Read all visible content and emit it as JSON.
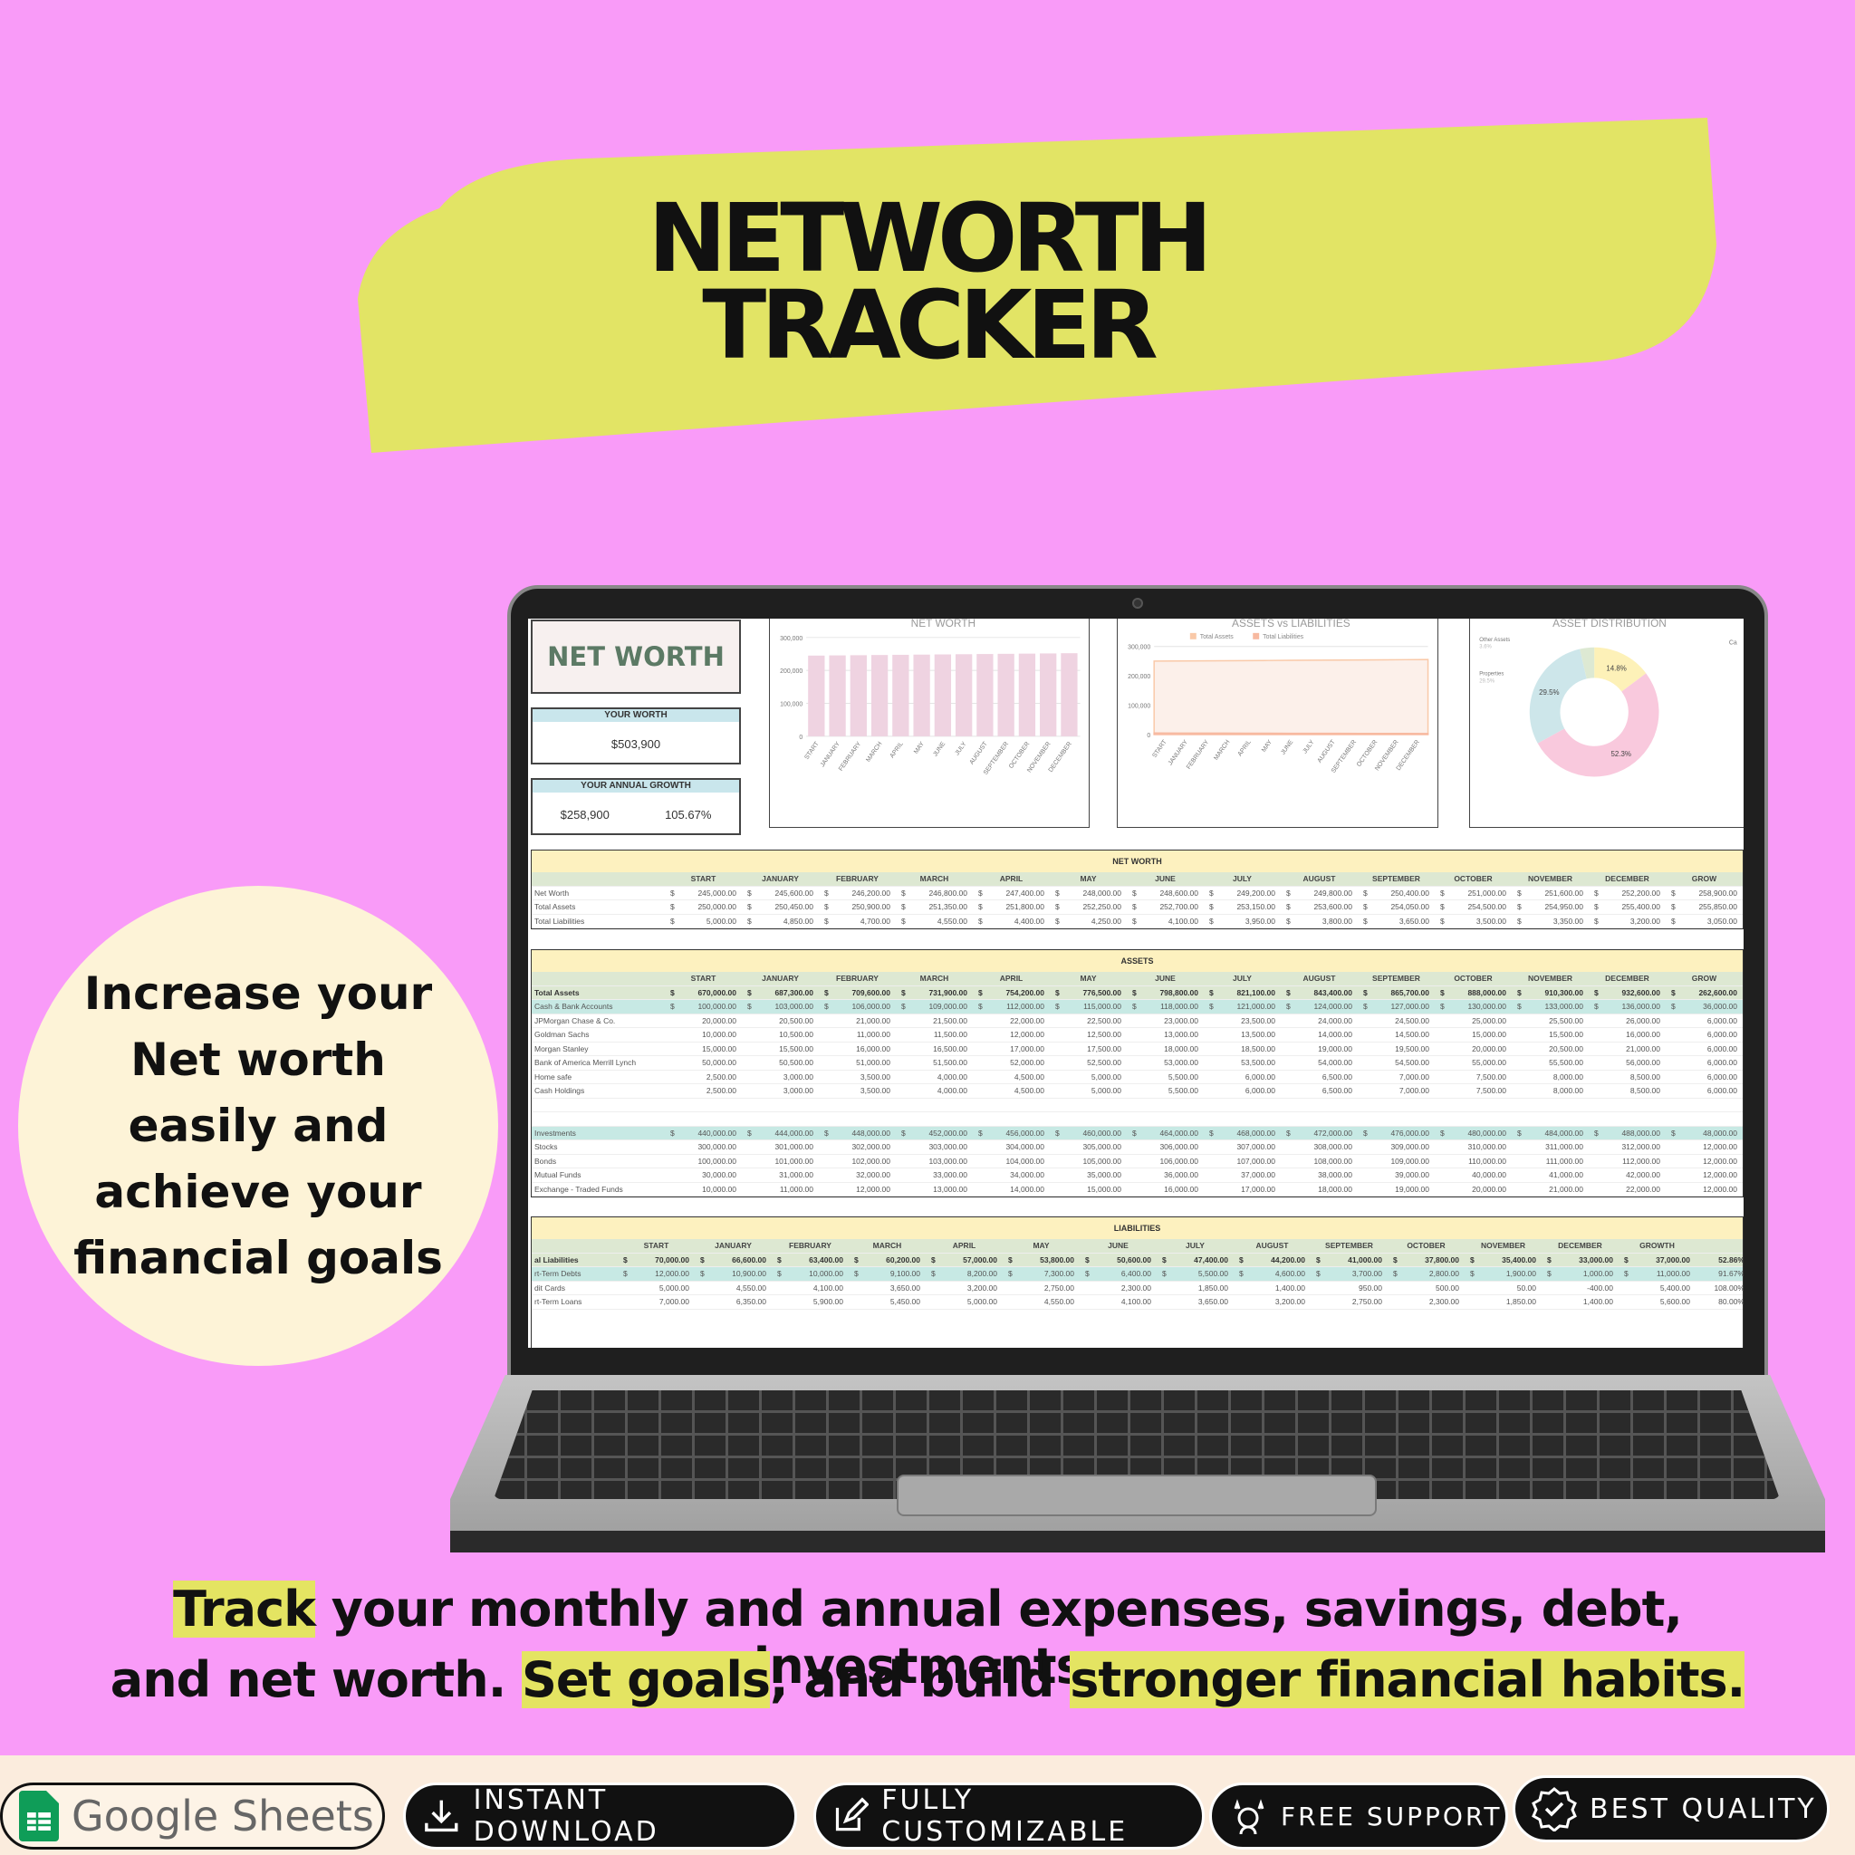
{
  "title": {
    "line1": "NETWORTH",
    "line2": "TRACKER"
  },
  "tagline": "Increase your Net worth easily and achieve your financial goals",
  "bottom": {
    "l1a": "Track",
    "l1b": " your monthly and annual expenses, savings, debt, investments,",
    "l2a": "and net worth. ",
    "l2b": "Set goals",
    "l2c": ", and build ",
    "l2d": "stronger financial habits."
  },
  "badges": {
    "google": "Google Sheets",
    "download": "INSTANT DOWNLOAD",
    "custom": "FULLY CUSTOMIZABLE",
    "support": "FREE SUPPORT",
    "quality": "BEST QUALITY"
  },
  "colors": {
    "background": "#f99bf8",
    "banner": "#e2e465",
    "circle": "#fdf3d7",
    "header": "#fdf1bf",
    "green": "#dde8d2",
    "teal": "#c7e9e4"
  },
  "sheet": {
    "logo": "NET WORTH",
    "your_worth_label": "YOUR WORTH",
    "your_worth": "$503,900",
    "growth_label": "YOUR ANNUAL GROWTH",
    "growth_amount": "$258,900",
    "growth_pct": "105.67%",
    "columns": [
      "START",
      "JANUARY",
      "FEBRUARY",
      "MARCH",
      "APRIL",
      "MAY",
      "JUNE",
      "JULY",
      "AUGUST",
      "SEPTEMBER",
      "OCTOBER",
      "NOVEMBER",
      "DECEMBER",
      "GROW"
    ],
    "networth_table": {
      "title": "NET WORTH",
      "rows": [
        {
          "label": "Net Worth",
          "dollar": true,
          "values": [
            "245,000.00",
            "245,600.00",
            "246,200.00",
            "246,800.00",
            "247,400.00",
            "248,000.00",
            "248,600.00",
            "249,200.00",
            "249,800.00",
            "250,400.00",
            "251,000.00",
            "251,600.00",
            "252,200.00",
            "258,900.00"
          ]
        },
        {
          "label": "Total Assets",
          "dollar": true,
          "values": [
            "250,000.00",
            "250,450.00",
            "250,900.00",
            "251,350.00",
            "251,800.00",
            "252,250.00",
            "252,700.00",
            "253,150.00",
            "253,600.00",
            "254,050.00",
            "254,500.00",
            "254,950.00",
            "255,400.00",
            "255,850.00"
          ]
        },
        {
          "label": "Total Liabilities",
          "dollar": true,
          "values": [
            "5,000.00",
            "4,850.00",
            "4,700.00",
            "4,550.00",
            "4,400.00",
            "4,250.00",
            "4,100.00",
            "3,950.00",
            "3,800.00",
            "3,650.00",
            "3,500.00",
            "3,350.00",
            "3,200.00",
            "3,050.00"
          ]
        }
      ]
    },
    "assets_table": {
      "title": "ASSETS",
      "rows": [
        {
          "label": "Total Assets",
          "style": "total",
          "dollar": true,
          "values": [
            "670,000.00",
            "687,300.00",
            "709,600.00",
            "731,900.00",
            "754,200.00",
            "776,500.00",
            "798,800.00",
            "821,100.00",
            "843,400.00",
            "865,700.00",
            "888,000.00",
            "910,300.00",
            "932,600.00",
            "262,600.00"
          ]
        },
        {
          "label": "Cash & Bank Accounts",
          "style": "sub",
          "dollar": true,
          "values": [
            "100,000.00",
            "103,000.00",
            "106,000.00",
            "109,000.00",
            "112,000.00",
            "115,000.00",
            "118,000.00",
            "121,000.00",
            "124,000.00",
            "127,000.00",
            "130,000.00",
            "133,000.00",
            "136,000.00",
            "36,000.00"
          ]
        },
        {
          "label": "JPMorgan Chase & Co.",
          "values": [
            "20,000.00",
            "20,500.00",
            "21,000.00",
            "21,500.00",
            "22,000.00",
            "22,500.00",
            "23,000.00",
            "23,500.00",
            "24,000.00",
            "24,500.00",
            "25,000.00",
            "25,500.00",
            "26,000.00",
            "6,000.00"
          ]
        },
        {
          "label": "Goldman Sachs",
          "values": [
            "10,000.00",
            "10,500.00",
            "11,000.00",
            "11,500.00",
            "12,000.00",
            "12,500.00",
            "13,000.00",
            "13,500.00",
            "14,000.00",
            "14,500.00",
            "15,000.00",
            "15,500.00",
            "16,000.00",
            "6,000.00"
          ]
        },
        {
          "label": "Morgan Stanley",
          "values": [
            "15,000.00",
            "15,500.00",
            "16,000.00",
            "16,500.00",
            "17,000.00",
            "17,500.00",
            "18,000.00",
            "18,500.00",
            "19,000.00",
            "19,500.00",
            "20,000.00",
            "20,500.00",
            "21,000.00",
            "6,000.00"
          ]
        },
        {
          "label": "Bank of America Merrill Lynch",
          "values": [
            "50,000.00",
            "50,500.00",
            "51,000.00",
            "51,500.00",
            "52,000.00",
            "52,500.00",
            "53,000.00",
            "53,500.00",
            "54,000.00",
            "54,500.00",
            "55,000.00",
            "55,500.00",
            "56,000.00",
            "6,000.00"
          ]
        },
        {
          "label": "Home safe",
          "values": [
            "2,500.00",
            "3,000.00",
            "3,500.00",
            "4,000.00",
            "4,500.00",
            "5,000.00",
            "5,500.00",
            "6,000.00",
            "6,500.00",
            "7,000.00",
            "7,500.00",
            "8,000.00",
            "8,500.00",
            "6,000.00"
          ]
        },
        {
          "label": "Cash Holdings",
          "values": [
            "2,500.00",
            "3,000.00",
            "3,500.00",
            "4,000.00",
            "4,500.00",
            "5,000.00",
            "5,500.00",
            "6,000.00",
            "6,500.00",
            "7,000.00",
            "7,500.00",
            "8,000.00",
            "8,500.00",
            "6,000.00"
          ]
        },
        {
          "label": "",
          "style": "blank",
          "values": []
        },
        {
          "label": "",
          "style": "blank",
          "values": []
        },
        {
          "label": "Investments",
          "style": "sub",
          "dollar": true,
          "values": [
            "440,000.00",
            "444,000.00",
            "448,000.00",
            "452,000.00",
            "456,000.00",
            "460,000.00",
            "464,000.00",
            "468,000.00",
            "472,000.00",
            "476,000.00",
            "480,000.00",
            "484,000.00",
            "488,000.00",
            "48,000.00"
          ]
        },
        {
          "label": "Stocks",
          "values": [
            "300,000.00",
            "301,000.00",
            "302,000.00",
            "303,000.00",
            "304,000.00",
            "305,000.00",
            "306,000.00",
            "307,000.00",
            "308,000.00",
            "309,000.00",
            "310,000.00",
            "311,000.00",
            "312,000.00",
            "12,000.00"
          ]
        },
        {
          "label": "Bonds",
          "values": [
            "100,000.00",
            "101,000.00",
            "102,000.00",
            "103,000.00",
            "104,000.00",
            "105,000.00",
            "106,000.00",
            "107,000.00",
            "108,000.00",
            "109,000.00",
            "110,000.00",
            "111,000.00",
            "112,000.00",
            "12,000.00"
          ]
        },
        {
          "label": "Mutual Funds",
          "values": [
            "30,000.00",
            "31,000.00",
            "32,000.00",
            "33,000.00",
            "34,000.00",
            "35,000.00",
            "36,000.00",
            "37,000.00",
            "38,000.00",
            "39,000.00",
            "40,000.00",
            "41,000.00",
            "42,000.00",
            "12,000.00"
          ]
        },
        {
          "label": "Exchange - Traded Funds",
          "values": [
            "10,000.00",
            "11,000.00",
            "12,000.00",
            "13,000.00",
            "14,000.00",
            "15,000.00",
            "16,000.00",
            "17,000.00",
            "18,000.00",
            "19,000.00",
            "20,000.00",
            "21,000.00",
            "22,000.00",
            "12,000.00"
          ]
        }
      ]
    },
    "liab_columns": [
      "START",
      "JANUARY",
      "FEBRUARY",
      "MARCH",
      "APRIL",
      "MAY",
      "JUNE",
      "JULY",
      "AUGUST",
      "SEPTEMBER",
      "OCTOBER",
      "NOVEMBER",
      "DECEMBER",
      "GROWTH",
      ""
    ],
    "liabilities_table": {
      "title": "LIABILITIES",
      "rows": [
        {
          "label": "al Liabilities",
          "style": "total",
          "dollar": true,
          "values": [
            "70,000.00",
            "66,600.00",
            "63,400.00",
            "60,200.00",
            "57,000.00",
            "53,800.00",
            "50,600.00",
            "47,400.00",
            "44,200.00",
            "41,000.00",
            "37,800.00",
            "35,400.00",
            "33,000.00",
            "37,000.00",
            "52.86%"
          ]
        },
        {
          "label": "rt-Term Debts",
          "style": "sub",
          "dollar": true,
          "values": [
            "12,000.00",
            "10,900.00",
            "10,000.00",
            "9,100.00",
            "8,200.00",
            "7,300.00",
            "6,400.00",
            "5,500.00",
            "4,600.00",
            "3,700.00",
            "2,800.00",
            "1,900.00",
            "1,000.00",
            "11,000.00",
            "91.67%"
          ]
        },
        {
          "label": "dit Cards",
          "values": [
            "5,000.00",
            "4,550.00",
            "4,100.00",
            "3,650.00",
            "3,200.00",
            "2,750.00",
            "2,300.00",
            "1,850.00",
            "1,400.00",
            "950.00",
            "500.00",
            "50.00",
            "-400.00",
            "5,400.00",
            "108.00%"
          ]
        },
        {
          "label": "rt-Term Loans",
          "values": [
            "7,000.00",
            "6,350.00",
            "5,900.00",
            "5,450.00",
            "5,000.00",
            "4,550.00",
            "4,100.00",
            "3,650.00",
            "3,200.00",
            "2,750.00",
            "2,300.00",
            "1,850.00",
            "1,400.00",
            "5,600.00",
            "80.00%"
          ]
        }
      ]
    }
  },
  "chart_data": [
    {
      "type": "bar",
      "title": "NET WORTH",
      "categories": [
        "START",
        "JANUARY",
        "FEBRUARY",
        "MARCH",
        "APRIL",
        "MAY",
        "JUNE",
        "JULY",
        "AUGUST",
        "SEPTEMBER",
        "OCTOBER",
        "NOVEMBER",
        "DECEMBER"
      ],
      "values": [
        245000,
        245600,
        246200,
        246800,
        247400,
        248000,
        248600,
        249200,
        249800,
        250400,
        251000,
        251600,
        252200
      ],
      "ylim": [
        0,
        300000
      ],
      "yticks": [
        "0",
        "100,000",
        "200,000",
        "300,000"
      ],
      "color": "#efd3e1"
    },
    {
      "type": "area",
      "title": "ASSETS vs LIABILITIES",
      "categories": [
        "START",
        "JANUARY",
        "FEBRUARY",
        "MARCH",
        "APRIL",
        "MAY",
        "JUNE",
        "JULY",
        "AUGUST",
        "SEPTEMBER",
        "OCTOBER",
        "NOVEMBER",
        "DECEMBER"
      ],
      "series": [
        {
          "name": "Total Assets",
          "values": [
            250000,
            250450,
            250900,
            251350,
            251800,
            252250,
            252700,
            253150,
            253600,
            254050,
            254500,
            254950,
            255400
          ],
          "color": "#f9c9a8"
        },
        {
          "name": "Total Liabilities",
          "values": [
            5000,
            4850,
            4700,
            4550,
            4400,
            4250,
            4100,
            3950,
            3800,
            3650,
            3500,
            3350,
            3200
          ],
          "color": "#f7b9a0"
        }
      ],
      "ylim": [
        0,
        300000
      ],
      "yticks": [
        "0",
        "100,000",
        "200,000",
        "300,000"
      ]
    },
    {
      "type": "pie",
      "title": "ASSET DISTRIBUTION",
      "slices": [
        {
          "label": "Ca",
          "value": 14.8,
          "text": "14.8%",
          "color": "#fdf1b8"
        },
        {
          "label": "",
          "value": 52.3,
          "text": "52.3%",
          "color": "#f9c9dd"
        },
        {
          "label": "Properties",
          "value": 29.5,
          "text": "29.5%",
          "color": "#cde6ea"
        },
        {
          "label": "Other Assets",
          "value": 3.6,
          "text": "3.6%",
          "color": "#dde9d3"
        }
      ]
    }
  ]
}
